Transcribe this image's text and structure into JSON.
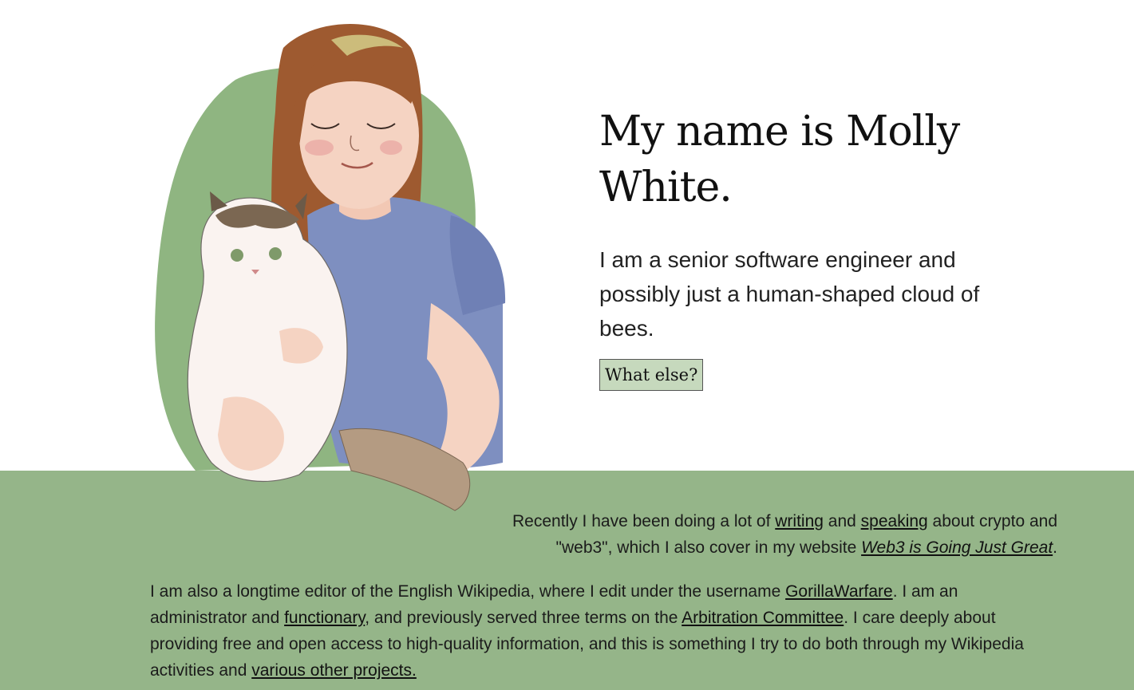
{
  "hero": {
    "title": "My name is Molly White.",
    "intro": "I am a senior software engineer and possibly just a human-shaped cloud of bees.",
    "button_label": "What else?"
  },
  "para1": {
    "t1": "Recently I have been doing a lot of ",
    "link_writing": "writing",
    "t2": " and ",
    "link_speaking": "speaking",
    "t3": " about crypto and \"web3\", which I also cover in my website ",
    "link_web3": "Web3 is Going Just Great",
    "t4": "."
  },
  "para2": {
    "t1": "I am also a longtime editor of the English Wikipedia, where I edit under the username ",
    "link_username": "GorillaWarfare",
    "t2": ". I am an administrator and ",
    "link_functionary": "functionary",
    "t3": ", and previously served three terms on the ",
    "link_arbcom": "Arbitration Committee",
    "t4": ". I care deeply about providing free and open access to high-quality information, and this is something I try to do both through my Wikipedia activities and ",
    "link_projects": "various other projects."
  },
  "colors": {
    "accent_green": "#95b589",
    "button_bg": "#c6d9bd",
    "shirt_blue": "#7e8fc0",
    "hair_brown": "#9e5a30"
  },
  "icons": {
    "portrait": "portrait-illustration-woman-with-cat"
  }
}
